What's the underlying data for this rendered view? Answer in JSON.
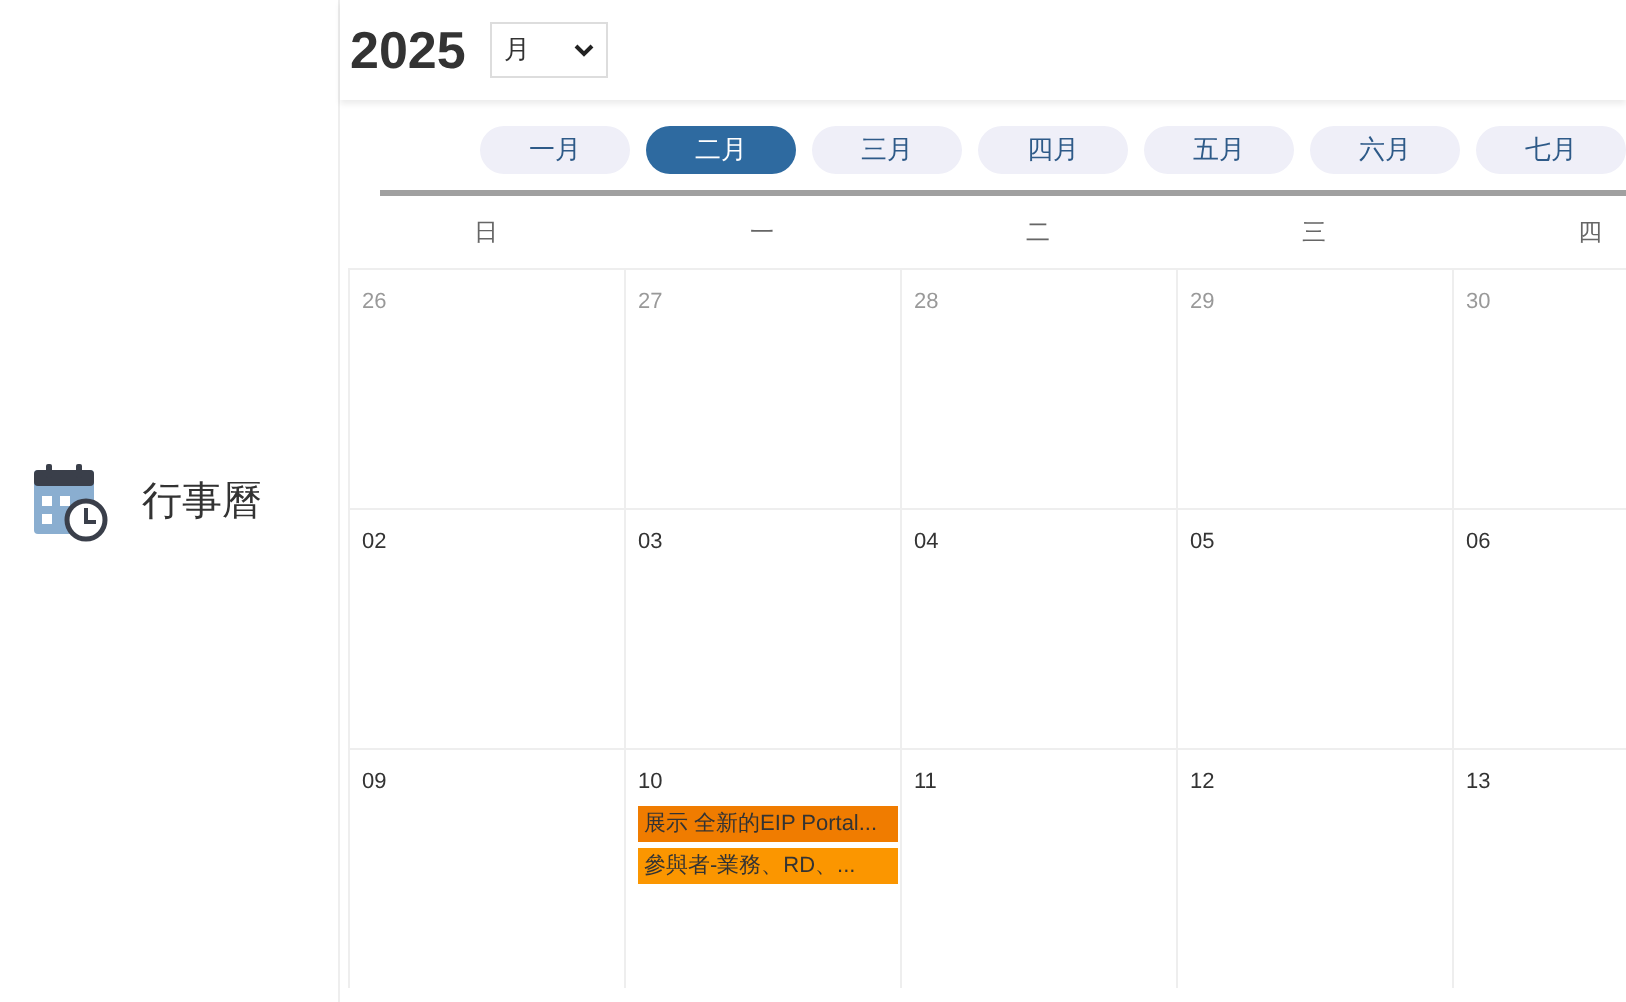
{
  "sidebar": {
    "label": "行事曆"
  },
  "header": {
    "year": "2025",
    "view_select": {
      "value": "月"
    }
  },
  "months": [
    {
      "label": "一月",
      "selected": false
    },
    {
      "label": "二月",
      "selected": true
    },
    {
      "label": "三月",
      "selected": false
    },
    {
      "label": "四月",
      "selected": false
    },
    {
      "label": "五月",
      "selected": false
    },
    {
      "label": "六月",
      "selected": false
    },
    {
      "label": "七月",
      "selected": false
    }
  ],
  "weekdays": [
    "日",
    "一",
    "二",
    "三",
    "四"
  ],
  "weeks": [
    [
      {
        "day": "26",
        "other_month": true
      },
      {
        "day": "27",
        "other_month": true
      },
      {
        "day": "28",
        "other_month": true
      },
      {
        "day": "29",
        "other_month": true
      },
      {
        "day": "30",
        "other_month": true
      }
    ],
    [
      {
        "day": "02",
        "other_month": false
      },
      {
        "day": "03",
        "other_month": false
      },
      {
        "day": "04",
        "other_month": false
      },
      {
        "day": "05",
        "other_month": false
      },
      {
        "day": "06",
        "other_month": false
      }
    ],
    [
      {
        "day": "09",
        "other_month": false
      },
      {
        "day": "10",
        "other_month": false,
        "events": [
          {
            "title": "展示 全新的EIP Portal...",
            "color": "#f07c00"
          },
          {
            "title": "參與者-業務、RD、...",
            "color": "#fb9600"
          }
        ]
      },
      {
        "day": "11",
        "other_month": false
      },
      {
        "day": "12",
        "other_month": false
      },
      {
        "day": "13",
        "other_month": false
      }
    ]
  ]
}
